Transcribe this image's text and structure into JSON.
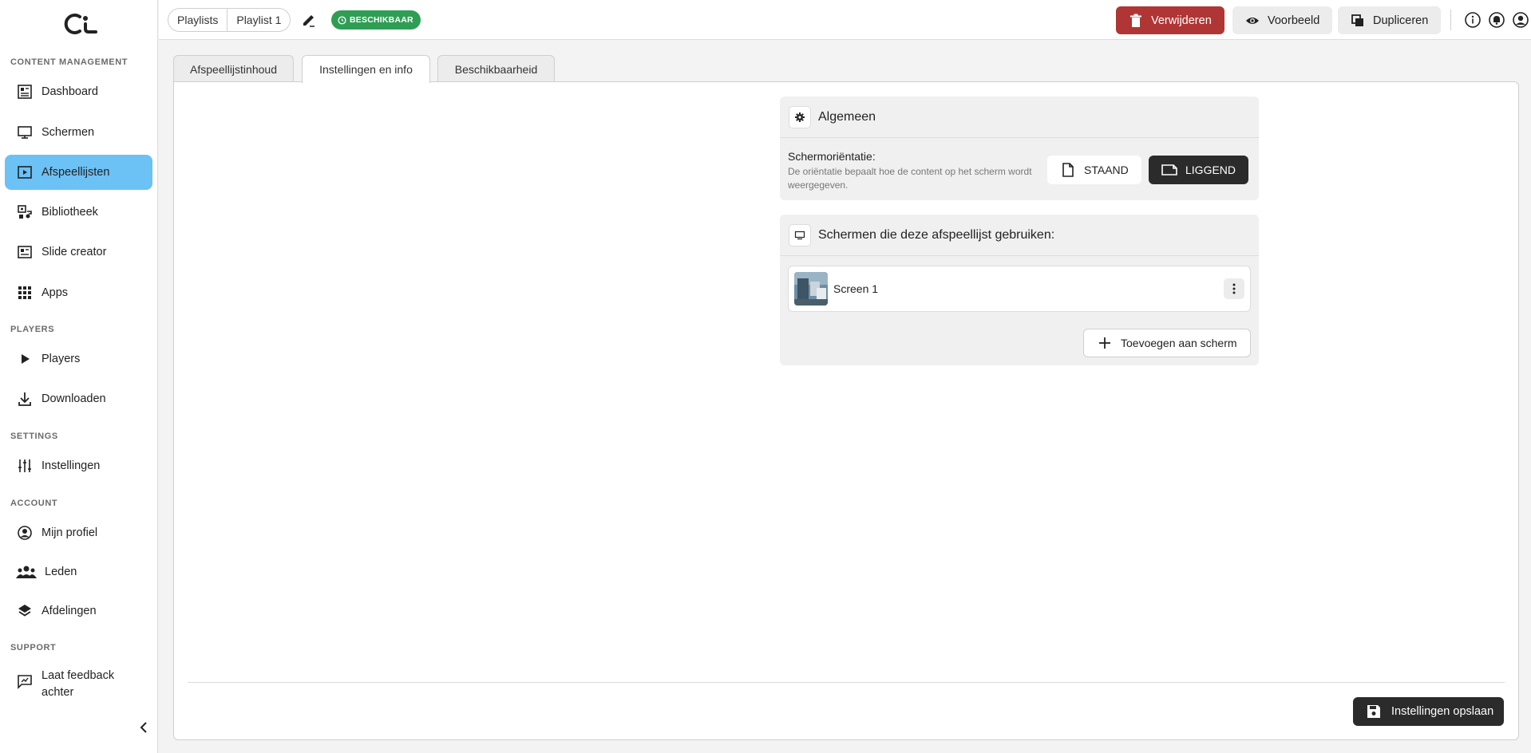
{
  "sidebar": {
    "logo": "ci-logo",
    "sections": [
      {
        "title": "CONTENT MANAGEMENT"
      },
      {
        "title": "PLAYERS"
      },
      {
        "title": "SETTINGS"
      },
      {
        "title": "ACCOUNT"
      },
      {
        "title": "SUPPORT"
      }
    ],
    "items": [
      {
        "label": "Dashboard",
        "icon": "dashboard-icon"
      },
      {
        "label": "Schermen",
        "icon": "monitor-icon"
      },
      {
        "label": "Afspeellijsten",
        "icon": "playlist-icon",
        "active": true
      },
      {
        "label": "Bibliotheek",
        "icon": "media-library-icon"
      },
      {
        "label": "Slide creator",
        "icon": "slide-icon"
      },
      {
        "label": "Apps",
        "icon": "apps-grid-icon"
      },
      {
        "label": "Players",
        "icon": "play-icon"
      },
      {
        "label": "Downloaden",
        "icon": "download-icon"
      },
      {
        "label": "Instellingen",
        "icon": "sliders-icon"
      },
      {
        "label": "Mijn profiel",
        "icon": "user-circle-icon"
      },
      {
        "label": "Leden",
        "icon": "group-icon"
      },
      {
        "label": "Afdelingen",
        "icon": "layers-icon"
      },
      {
        "label": "Laat feedback achter",
        "label_line1": "Laat feedback",
        "label_line2": "achter",
        "icon": "feedback-icon"
      }
    ]
  },
  "header": {
    "breadcrumbs": [
      "Playlists",
      "Playlist 1"
    ],
    "status_badge": "BESCHIKBAAR",
    "buttons": {
      "delete": "Verwijderen",
      "preview": "Voorbeeld",
      "duplicate": "Dupliceren"
    }
  },
  "tabs": [
    "Afspeellijstinhoud",
    "Instellingen en info",
    "Beschikbaarheid"
  ],
  "active_tab": "Instellingen en info",
  "general": {
    "title": "Algemeen",
    "orientation_label": "Schermoriëntatie:",
    "orientation_desc": "De oriëntatie bepaalt hoe de content op het scherm wordt weergegeven.",
    "portrait": "STAAND",
    "landscape": "LIGGEND",
    "selected": "LIGGEND"
  },
  "screens": {
    "title": "Schermen die deze afspeellijst gebruiken:",
    "items": [
      {
        "name": "Screen 1"
      }
    ],
    "add_label": "Toevoegen aan scherm"
  },
  "footer": {
    "save_label": "Instellingen opslaan"
  },
  "colors": {
    "accent": "#6cc1f5",
    "danger": "#b03535",
    "success": "#2f9e55",
    "dark": "#2b2b2b"
  }
}
